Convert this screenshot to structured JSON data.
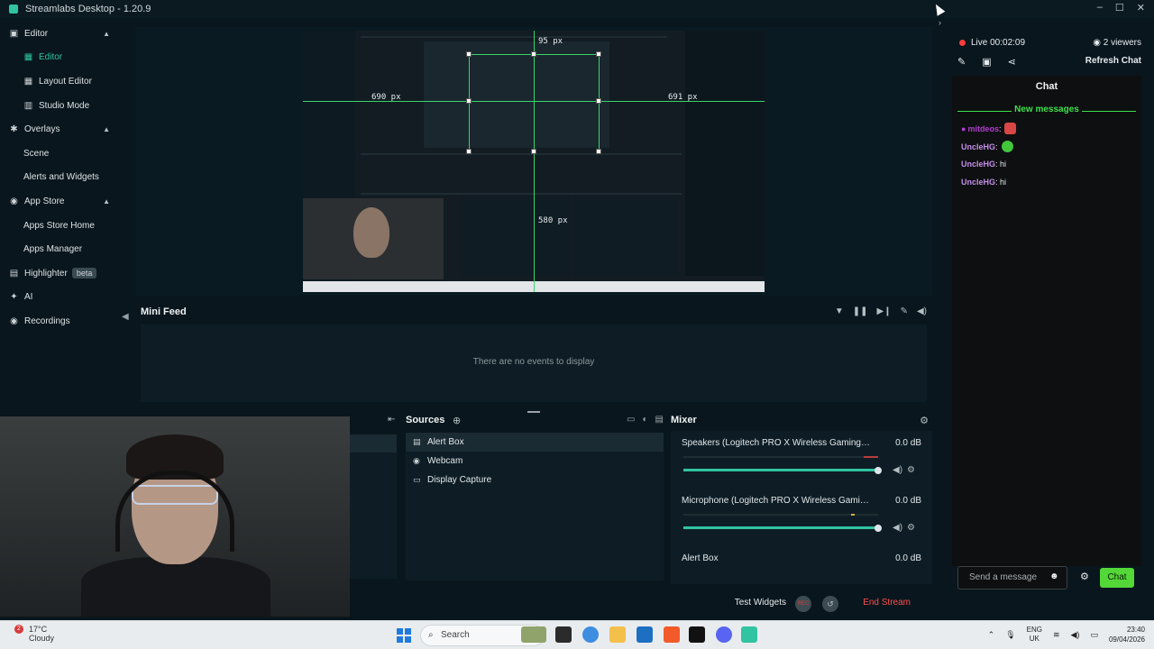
{
  "window": {
    "title": "Streamlabs Desktop - 1.20.9",
    "min": "–",
    "max": "☐",
    "close": "✕"
  },
  "sidebar": {
    "items": [
      {
        "label": "Editor",
        "type": "section",
        "icon": "editor-icon"
      },
      {
        "label": "Editor",
        "type": "sub",
        "icon": "grid-icon",
        "active": true
      },
      {
        "label": "Layout Editor",
        "type": "sub",
        "icon": "layout-icon"
      },
      {
        "label": "Studio Mode",
        "type": "sub",
        "icon": "studio-icon"
      },
      {
        "label": "Overlays",
        "type": "section",
        "icon": "overlays-icon"
      },
      {
        "label": "Scene",
        "type": "sub"
      },
      {
        "label": "Alerts and Widgets",
        "type": "sub"
      },
      {
        "label": "App Store",
        "type": "section",
        "icon": "appstore-icon"
      },
      {
        "label": "Apps Store Home",
        "type": "sub"
      },
      {
        "label": "Apps Manager",
        "type": "sub"
      },
      {
        "label": "Highlighter",
        "type": "section",
        "icon": "highlighter-icon",
        "badge": "beta"
      },
      {
        "label": "AI",
        "type": "section",
        "icon": "ai-icon"
      },
      {
        "label": "Recordings",
        "type": "section",
        "icon": "recordings-icon"
      }
    ]
  },
  "preview": {
    "labels": [
      "95 px",
      "690 px",
      "691 px",
      "580 px"
    ]
  },
  "mini_feed": {
    "title": "Mini Feed",
    "empty": "There are no events to display"
  },
  "sources": {
    "title": "Sources",
    "items": [
      "Alert Box",
      "Webcam",
      "Display Capture"
    ]
  },
  "mixer": {
    "title": "Mixer",
    "channels": [
      {
        "name": "Speakers (Logitech PRO X Wireless Gaming Headset)",
        "db": "0.0 dB"
      },
      {
        "name": "Microphone (Logitech PRO X Wireless Gaming Head...",
        "db": "0.0 dB"
      },
      {
        "name": "Alert Box",
        "db": "0.0 dB"
      }
    ]
  },
  "footer": {
    "test_widgets": "Test Widgets",
    "end_stream": "End Stream"
  },
  "right_panel": {
    "live": "Live 00:02:09",
    "viewers": "2 viewers",
    "refresh_chat": "Refresh Chat",
    "chat_title": "Chat",
    "new_messages": "New messages",
    "messages": [
      {
        "user": "mitdeos",
        "text": ":",
        "user_color": "#b23ecf"
      },
      {
        "user": "UncleHG",
        "text": ":",
        "user_color": "#c48ee8"
      },
      {
        "user": "UncleHG",
        "text": ": hi",
        "user_color": "#c48ee8"
      },
      {
        "user": "UncleHG",
        "text": ": hi",
        "user_color": "#c48ee8"
      }
    ],
    "send_placeholder": "Send a message",
    "send_button": "Chat"
  },
  "taskbar": {
    "weather_temp": "17°C",
    "weather_desc": "Cloudy",
    "weather_badge": "2",
    "search": "Search",
    "lang_top": "ENG",
    "lang_bottom": "UK",
    "time": "23:40",
    "date": "09/04/2026"
  },
  "colors": {
    "accent": "#31c3a2",
    "live": "#ff3b3b",
    "chat_green": "#53d837",
    "end_stream": "#ff4f4f"
  }
}
